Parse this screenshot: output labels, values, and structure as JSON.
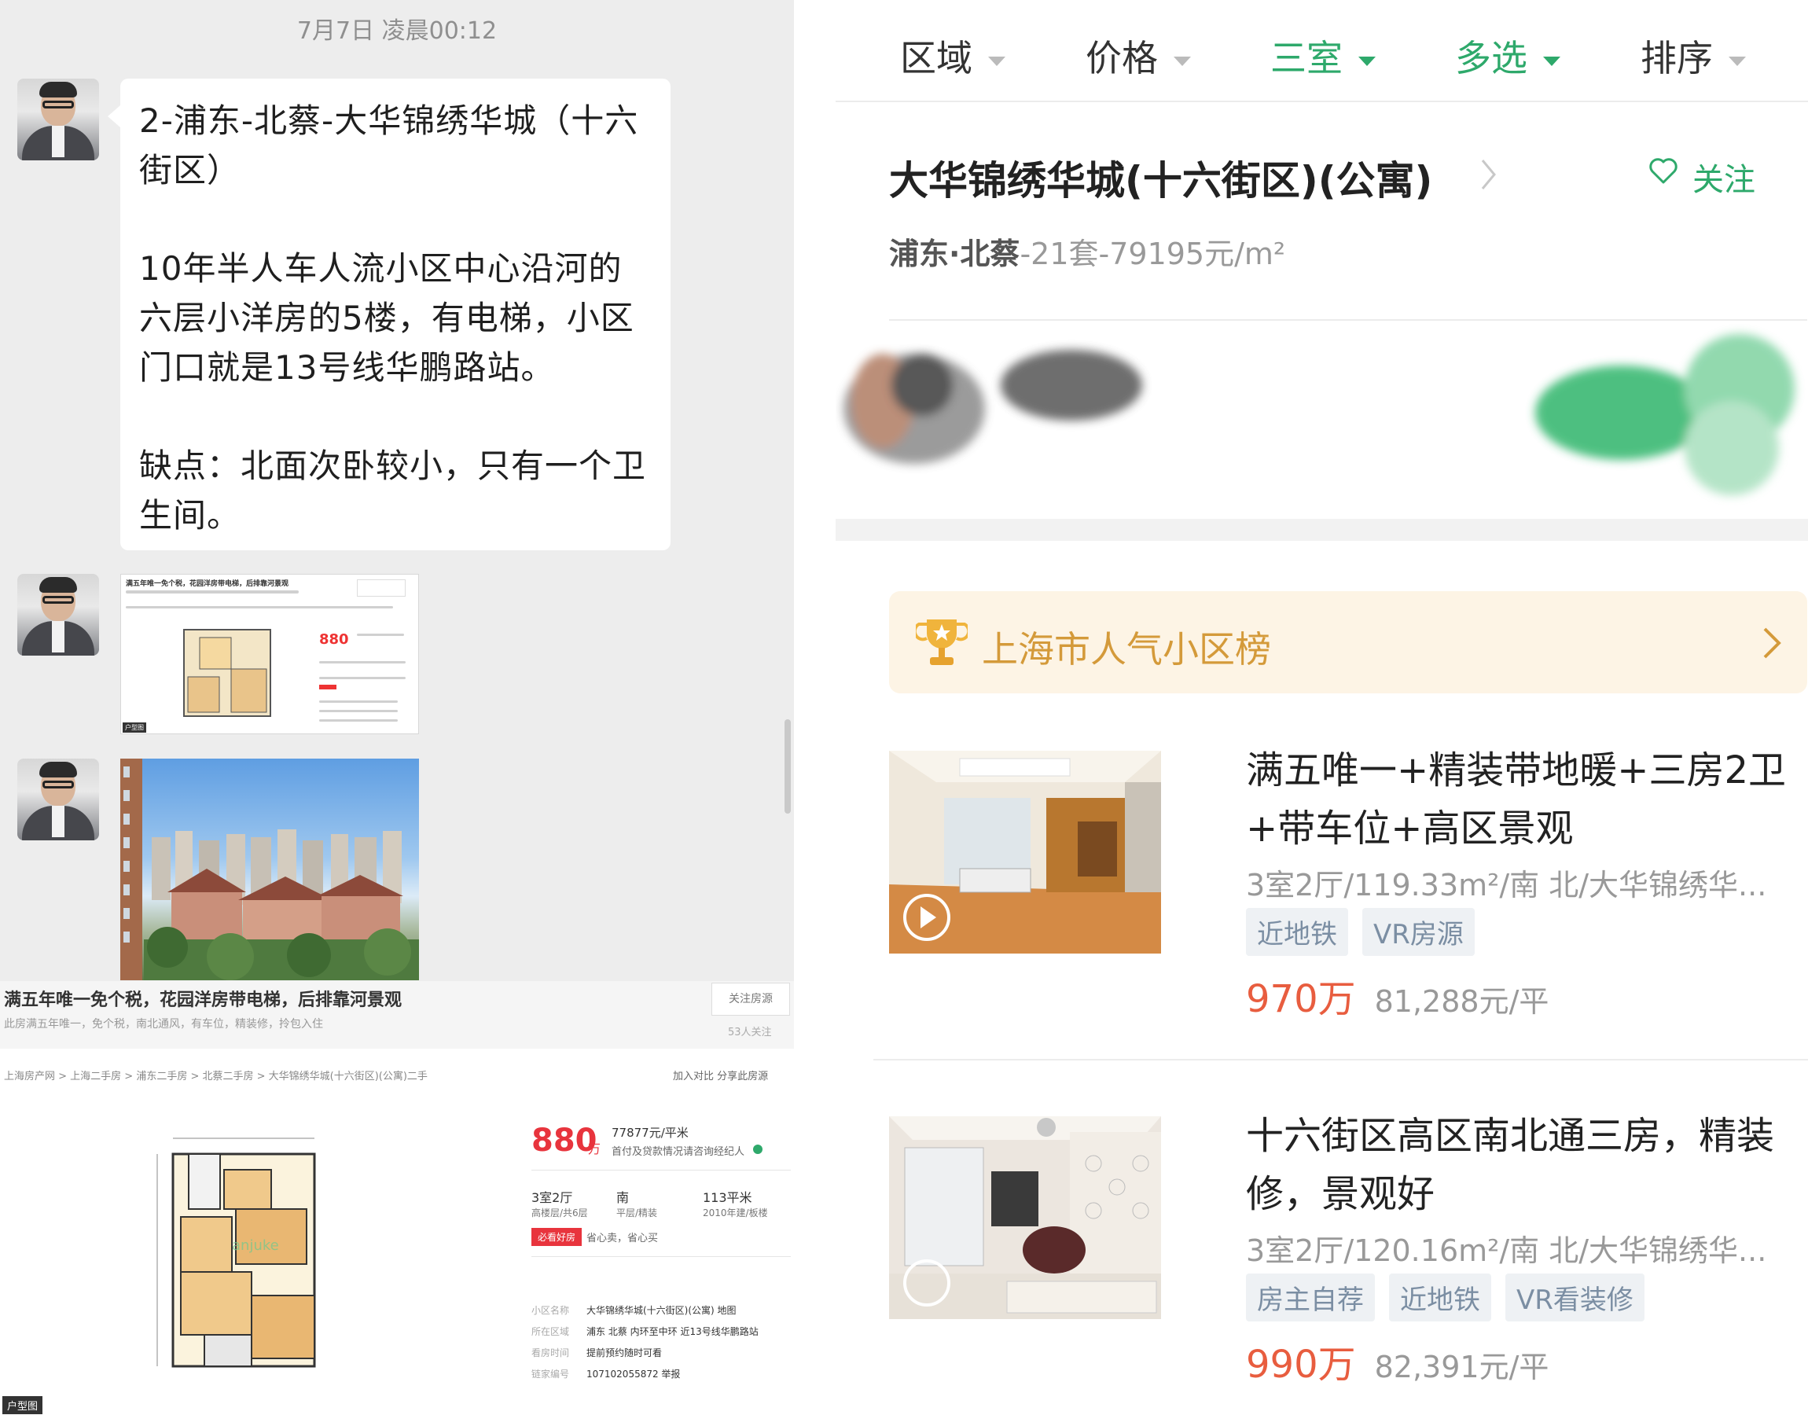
{
  "chat": {
    "timestamp": "7月7日 凌晨00:12",
    "message": {
      "line1": "2-浦东-北蔡-大华锦绣华城（十六街区）",
      "line2": "10年半人车人流小区中心沿河的六层小洋房的5楼，有电梯，小区门口就是13号线华鹏路站。",
      "line3": "缺点：北面次卧较小，只有一个卫生间。"
    },
    "thumb": {
      "title": "满五年唯一免个税，花园洋房带电梯，后排靠河景观",
      "price": "880",
      "tag": "户型图"
    }
  },
  "listing_shot": {
    "title": "满五年唯一免个税，花园洋房带电梯，后排靠河景观",
    "subtitle": "此房满五年唯一，免个税，南北通风，有车位，精装修，拎包入住",
    "follow_button": "关注房源",
    "followers": "53人关注",
    "breadcrumb": "上海房产网  >  上海二手房  >  浦东二手房  >  北蔡二手房  >  大华锦绣华城(十六街区)(公寓)二手",
    "actions": "加入对比  分享此房源",
    "price": "880",
    "price_unit": "万",
    "unit_price": "77877元/平米",
    "payment_note": "首付及贷款情况请咨询经纪人",
    "layout": "3室2厅",
    "layout_sub": "高楼层/共6层",
    "orientation": "南",
    "orientation_sub": "平层/精装",
    "area": "113平米",
    "area_sub": "2010年建/板楼",
    "badge": "必看好房",
    "badge_note": "省心卖，省心买",
    "rows": [
      {
        "label": "小区名称",
        "value": "大华锦绣华城(十六街区)(公寓)  地图"
      },
      {
        "label": "所在区域",
        "value": "浦东 北蔡 内环至中环  近13号线华鹏路站"
      },
      {
        "label": "看房时间",
        "value": "提前预约随时可看"
      },
      {
        "label": "链家编号",
        "value": "107102055872  举报"
      }
    ],
    "floorplan_tag": "户型图"
  },
  "app": {
    "filters": [
      {
        "label": "区域",
        "active": false
      },
      {
        "label": "价格",
        "active": false
      },
      {
        "label": "三室",
        "active": true
      },
      {
        "label": "多选",
        "active": true
      },
      {
        "label": "排序",
        "active": false
      }
    ],
    "community": {
      "name": "大华锦绣华城(十六街区)(公寓)",
      "follow": "关注",
      "location": "浦东·北蔡",
      "stats": "-21套-79195元/m²"
    },
    "ranking": "上海市人气小区榜",
    "listings": [
      {
        "title": "满五唯一+精装带地暖+三房2卫+带车位+高区景观",
        "meta": "3室2厅/119.33m²/南 北/大华锦绣华...",
        "tags": [
          "近地铁",
          "VR房源"
        ],
        "price": "970万",
        "unit_price": "81,288元/平"
      },
      {
        "title": "十六街区高区南北通三房，精装修，景观好",
        "meta": "3室2厅/120.16m²/南 北/大华锦绣华...",
        "tags": [
          "房主自荐",
          "近地铁",
          "VR看装修"
        ],
        "price": "990万",
        "unit_price": "82,391元/平"
      }
    ],
    "colors": {
      "accent": "#2ea96b",
      "price": "#e85d3f",
      "rank_text": "#d49a3a"
    }
  }
}
